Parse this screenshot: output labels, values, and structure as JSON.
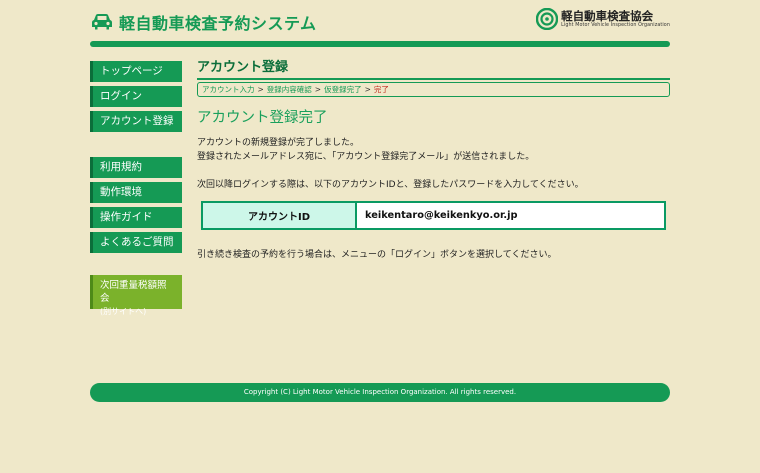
{
  "header": {
    "site_title": "軽自動車検査予約システム",
    "org_name": "軽自動車検査協会",
    "org_sub": "Light Motor Vehicle Inspection Organization"
  },
  "sidebar": {
    "items": [
      {
        "label": "トップページ"
      },
      {
        "label": "ログイン"
      },
      {
        "label": "アカウント登録"
      },
      {
        "label": "利用規約"
      },
      {
        "label": "動作環境"
      },
      {
        "label": "操作ガイド"
      },
      {
        "label": "よくあるご質問"
      }
    ],
    "external": {
      "label": "次回重量税額照会",
      "note": "(別サイトへ)"
    }
  },
  "main": {
    "page_heading": "アカウント登録",
    "breadcrumb": [
      {
        "label": "アカウント入力"
      },
      {
        "label": "登録内容確認"
      },
      {
        "label": "仮登録完了"
      },
      {
        "label": "完了"
      }
    ],
    "breadcrumb_sep": ">",
    "sub_heading": "アカウント登録完了",
    "message_line1": "アカウントの新規登録が完了しました。",
    "message_line2": "登録されたメールアドレス宛に、「アカウント登録完了メール」が送信されました。",
    "message_line3": "次回以降ログインする際は、以下のアカウントIDと、登録したパスワードを入力してください。",
    "account_id_label": "アカウントID",
    "account_id_value": "keikentaro@keikenkyo.or.jp",
    "message_line4": "引き続き検査の予約を行う場合は、メニューの「ログイン」ボタンを選択してください。"
  },
  "footer": {
    "copyright": "Copyright (C) Light Motor Vehicle Inspection Organization. All rights reserved."
  },
  "colors": {
    "accent": "#159a55",
    "background": "#efe8c9",
    "table_border": "#0a9a63",
    "breadcrumb_current": "#c02a1f"
  }
}
